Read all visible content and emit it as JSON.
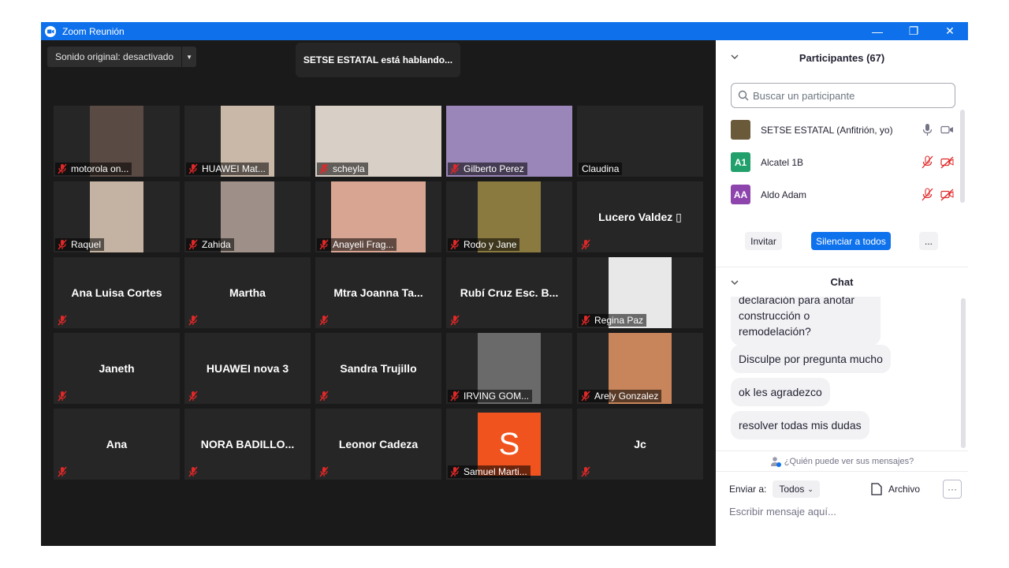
{
  "window": {
    "title": "Zoom Reunión",
    "controls": {
      "minimize": "—",
      "restore": "❐",
      "close": "✕"
    }
  },
  "video": {
    "sound_label": "Sonido original: desactivado",
    "speaking_banner": "SETSE ESTATAL está hablando...",
    "tiles": [
      {
        "name": "motorola on...",
        "type": "photo"
      },
      {
        "name": "HUAWEI Mat...",
        "type": "photo"
      },
      {
        "name": "scheyla",
        "type": "photo"
      },
      {
        "name": "Gilberto Perez",
        "type": "photo"
      },
      {
        "name": "Claudina",
        "type": "dark"
      },
      {
        "name": "Raquel",
        "type": "photo"
      },
      {
        "name": "Zahida",
        "type": "photo"
      },
      {
        "name": "Anayeli Frag...",
        "type": "photo"
      },
      {
        "name": "Rodo y Jane",
        "type": "photo"
      },
      {
        "name": "Lucero  Valdez ▯",
        "type": "text"
      },
      {
        "name": "Ana Luisa Cortes",
        "type": "text"
      },
      {
        "name": "Martha",
        "type": "text"
      },
      {
        "name": "Mtra  Joanna  Ta...",
        "type": "text"
      },
      {
        "name": "Rubí  Cruz  Esc.  B...",
        "type": "text"
      },
      {
        "name": "Regina Paz",
        "type": "photo"
      },
      {
        "name": "Janeth",
        "type": "text"
      },
      {
        "name": "HUAWEI nova 3",
        "type": "text"
      },
      {
        "name": "Sandra Trujillo",
        "type": "text"
      },
      {
        "name": "IRVING GOM...",
        "type": "photo"
      },
      {
        "name": "Arely Gonzalez",
        "type": "photo"
      },
      {
        "name": "Ana",
        "type": "text"
      },
      {
        "name": "NORA  BADILLO...",
        "type": "text"
      },
      {
        "name": "Leonor Cadeza",
        "type": "text"
      },
      {
        "name": "Samuel Marti...",
        "type": "avatar",
        "initial": "S"
      },
      {
        "name": "Jc",
        "type": "text"
      }
    ]
  },
  "participants": {
    "title": "Participantes (67)",
    "search_placeholder": "Buscar un participante",
    "list": [
      {
        "name": "SETSE ESTATAL (Anfitrión, yo)",
        "initials": "",
        "color": "#6b5a3a"
      },
      {
        "name": "Alcatel 1B",
        "initials": "A1",
        "color": "#22a06b"
      },
      {
        "name": "Aldo Adam",
        "initials": "AA",
        "color": "#8e44ad"
      }
    ],
    "invite": "Invitar",
    "mute_all": "Silenciar a todos",
    "more": "..."
  },
  "chat": {
    "title": "Chat",
    "messages": [
      "declaración para anotar construcción o remodelación?",
      "Disculpe por pregunta mucho",
      "ok les agradezco",
      "resolver todas mis dudas"
    ],
    "who_sees": "¿Quién puede ver sus mensajes?",
    "send_to_label": "Enviar a:",
    "send_to_value": "Todos",
    "file_label": "Archivo",
    "more": "···",
    "input_placeholder": "Escribir mensaje aquí..."
  },
  "colors": {
    "titlebar": "#0e71eb",
    "accent": "#0e72ed",
    "muted_red": "#e02828"
  }
}
